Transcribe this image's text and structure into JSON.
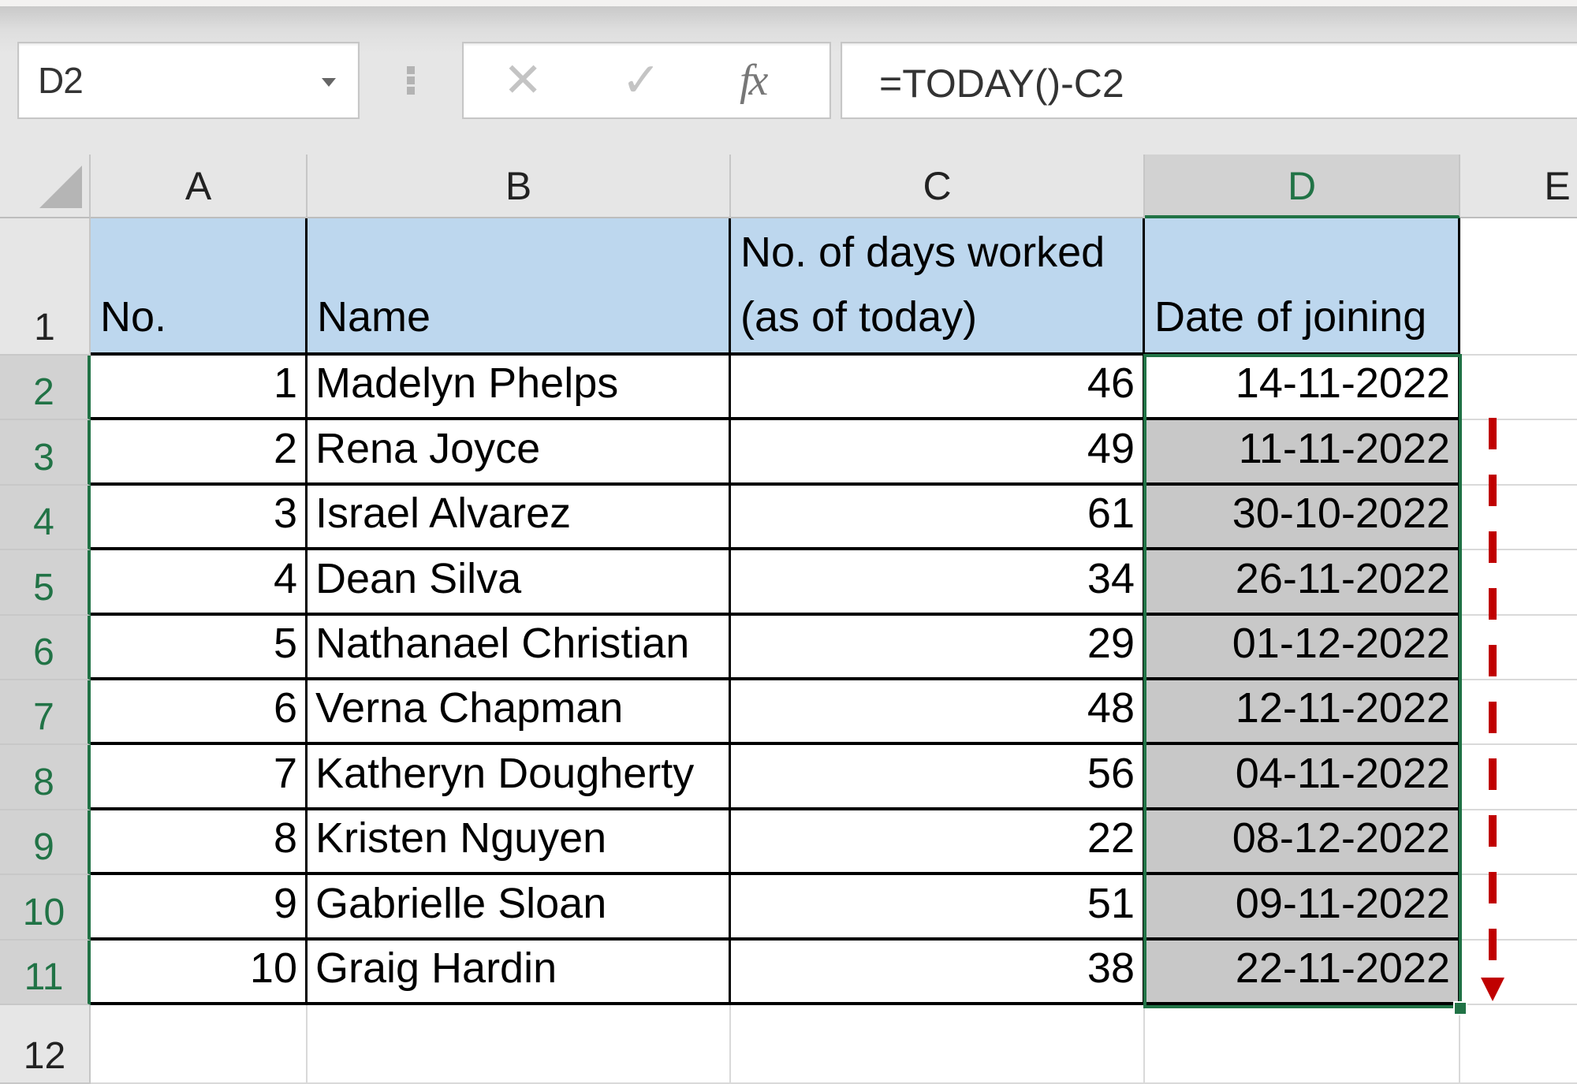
{
  "app": "Microsoft Excel",
  "formula_bar": {
    "name_box": "D2",
    "cancel_icon": "cancel-icon",
    "enter_icon": "enter-icon",
    "function_icon_label": "fx",
    "formula": "=TODAY()-C2"
  },
  "columns": [
    "A",
    "B",
    "C",
    "D",
    "E"
  ],
  "selected_column": "D",
  "rows_visible": [
    "1",
    "2",
    "3",
    "4",
    "5",
    "6",
    "7",
    "8",
    "9",
    "10",
    "11",
    "12"
  ],
  "selected_rows": [
    "2",
    "3",
    "4",
    "5",
    "6",
    "7",
    "8",
    "9",
    "10",
    "11"
  ],
  "selection": {
    "range": "D2:D11",
    "active_cell": "D2"
  },
  "table": {
    "headers": [
      "No.",
      "Name",
      "No. of days worked\n(as of today)",
      "Date of joining"
    ],
    "rows": [
      {
        "no": "1",
        "name": "Madelyn Phelps",
        "days": "46",
        "date": "14-11-2022"
      },
      {
        "no": "2",
        "name": "Rena Joyce",
        "days": "49",
        "date": "11-11-2022"
      },
      {
        "no": "3",
        "name": "Israel Alvarez",
        "days": "61",
        "date": "30-10-2022"
      },
      {
        "no": "4",
        "name": "Dean Silva",
        "days": "34",
        "date": "26-11-2022"
      },
      {
        "no": "5",
        "name": "Nathanael Christian",
        "days": "29",
        "date": "01-12-2022"
      },
      {
        "no": "6",
        "name": "Verna Chapman",
        "days": "48",
        "date": "12-11-2022"
      },
      {
        "no": "7",
        "name": "Katheryn Dougherty",
        "days": "56",
        "date": "04-11-2022"
      },
      {
        "no": "8",
        "name": "Kristen Nguyen",
        "days": "22",
        "date": "08-12-2022"
      },
      {
        "no": "9",
        "name": "Gabrielle Sloan",
        "days": "51",
        "date": "09-11-2022"
      },
      {
        "no": "10",
        "name": "Graig Hardin",
        "days": "38",
        "date": "22-11-2022"
      }
    ]
  },
  "annotation": {
    "type": "dashed-down-arrow",
    "color": "#c00000"
  },
  "colors": {
    "accent_green": "#217346",
    "header_fill": "#bdd7ee",
    "selection_fill": "#c8c8c8"
  }
}
